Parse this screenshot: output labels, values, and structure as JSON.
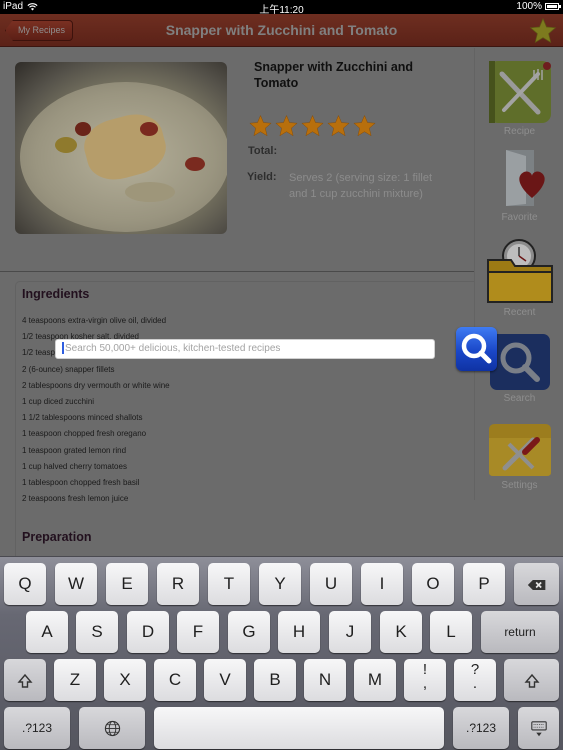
{
  "status_bar": {
    "device": "iPad",
    "time": "上午11:20",
    "battery": "100%"
  },
  "nav": {
    "back_label": "My Recipes",
    "title": "Snapper with Zucchini and Tomato",
    "favorite_icon": "star-icon"
  },
  "recipe": {
    "title": "Snapper with Zucchini and Tomato",
    "rating": 5,
    "rating_max": 5,
    "total_label": "Total:",
    "total_value": "",
    "yield_label": "Yield:",
    "yield_value": "Serves 2 (serving size: 1 fillet and 1 cup zucchini mixture)"
  },
  "ingredients": {
    "heading": "Ingredients",
    "items": [
      "4 teaspoons extra-virgin olive oil, divided",
      "1/2 teaspoon kosher salt, divided",
      "1/2 teaspoon",
      "2 (6-ounce) snapper fillets",
      "2 tablespoons dry vermouth or white wine",
      "1 cup diced zucchini",
      "1 1/2 tablespoons minced shallots",
      "1 teaspoon chopped fresh oregano",
      "1 teaspoon grated lemon rind",
      "1 cup halved cherry tomatoes",
      "1 tablespoon chopped fresh basil",
      "2 teaspoons fresh lemon juice"
    ]
  },
  "preparation": {
    "heading": "Preparation"
  },
  "sidebar": {
    "items": [
      {
        "label": "Recipe",
        "icon": "fork-knife-icon"
      },
      {
        "label": "Favorite",
        "icon": "heart-folder-icon"
      },
      {
        "label": "Recent",
        "icon": "clock-folder-icon"
      },
      {
        "label": "Search",
        "icon": "magnifier-icon"
      },
      {
        "label": "Settings",
        "icon": "tools-folder-icon"
      }
    ]
  },
  "search": {
    "placeholder": "Search 50,000+ delicious, kitchen-tested recipes",
    "value": ""
  },
  "keyboard": {
    "row1": [
      "Q",
      "W",
      "E",
      "R",
      "T",
      "Y",
      "U",
      "I",
      "O",
      "P"
    ],
    "row2": [
      "A",
      "S",
      "D",
      "F",
      "G",
      "H",
      "J",
      "K",
      "L"
    ],
    "row3": [
      "Z",
      "X",
      "C",
      "V",
      "B",
      "N",
      "M"
    ],
    "return_label": "return",
    "numbers_label": ".?123",
    "punct1_top": "!",
    "punct1_bottom": ",",
    "punct2_top": "?",
    "punct2_bottom": "."
  }
}
